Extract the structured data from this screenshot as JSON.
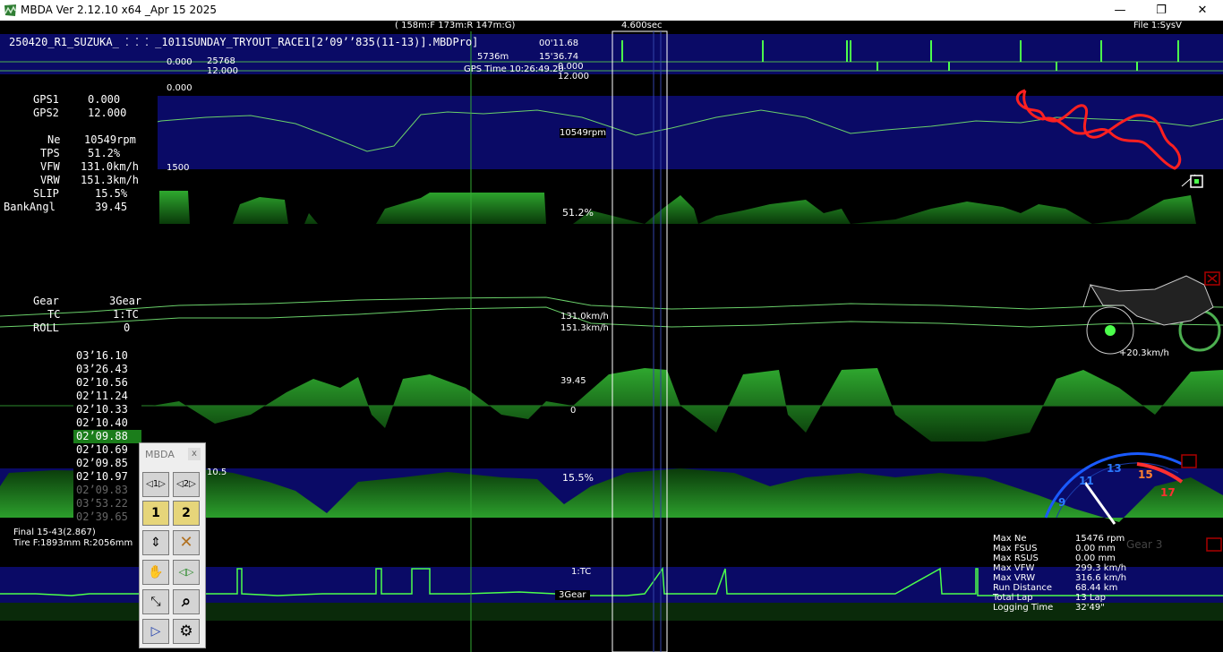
{
  "window": {
    "title": "MBDA Ver 2.12.10 x64 _Apr 15 2025",
    "minimize_label": "—",
    "maximize_label": "❐",
    "close_label": "✕"
  },
  "header": {
    "file_name": "250420_R1_SUZUKA_ ⁚ ⁚ ⁚ _1011SUNDAY_TRYOUT_RACE1[2’09’’835(11-13)].MBDPro]",
    "g_readout": "( 158m:F 173m:R 147m:G)",
    "window_span": "4.600sec",
    "file_tag": "File 1:SysV",
    "time_top": "00'11.68",
    "dist_m": "5736m",
    "time_total": "15'36.74",
    "gps_time": "GPS Time  10:26:49.20",
    "v_zero_1": "0.000",
    "v_25768": "25768",
    "v_12_1": "12.000",
    "v_zero_2": "0.000",
    "v_12_2": "12.000",
    "v_zero_3": "0.000"
  },
  "channels": [
    {
      "name": "GPS1",
      "value": "0.000"
    },
    {
      "name": "GPS2",
      "value": "12.000"
    },
    {
      "name": "Ne",
      "value": "10549rpm"
    },
    {
      "name": "TPS",
      "value": "51.2%"
    },
    {
      "name": "VFW",
      "value": "131.0km/h"
    },
    {
      "name": "VRW",
      "value": "151.3km/h"
    },
    {
      "name": "SLIP",
      "value": "15.5%"
    },
    {
      "name": "BankAngl",
      "value": "39.45"
    },
    {
      "name": "Gear",
      "value": "3Gear"
    },
    {
      "name": "TC",
      "value": "1:TC"
    },
    {
      "name": "ROLL",
      "value": "0"
    }
  ],
  "chart_labels": {
    "rpm": "10549rpm",
    "rpm_min": "1500",
    "tps": "51.2%",
    "vfw": "131.0km/h",
    "vrw": "151.3km/h",
    "bank": "39.45",
    "roll": "0",
    "slip_scale": "10.5",
    "slip": "15.5%",
    "tc": "1:TC",
    "gear": "3Gear",
    "bike_speed": "+20.3km/h"
  },
  "laps": [
    {
      "time": "03’16.10",
      "state": "normal"
    },
    {
      "time": "03’26.43",
      "state": "normal"
    },
    {
      "time": "02’10.56",
      "state": "normal"
    },
    {
      "time": "02’11.24",
      "state": "normal"
    },
    {
      "time": "02’10.33",
      "state": "normal"
    },
    {
      "time": "02’10.40",
      "state": "normal"
    },
    {
      "time": "02’09.88",
      "state": "selected"
    },
    {
      "time": "02’10.69",
      "state": "normal"
    },
    {
      "time": "02’09.85",
      "state": "normal"
    },
    {
      "time": "02’10.97",
      "state": "normal"
    },
    {
      "time": "02’09.83",
      "state": "dim"
    },
    {
      "time": "03’53.22",
      "state": "dim"
    },
    {
      "time": "02’39.65",
      "state": "dim"
    }
  ],
  "lap_info": {
    "final": "Final 15-43(2.867)",
    "tire": "Tire F:1893mm R:2056mm"
  },
  "palette": {
    "title": "MBDA",
    "close": "x",
    "buttons": [
      {
        "id": "prev-marker-1",
        "label": "◁1▷"
      },
      {
        "id": "prev-marker-2",
        "label": "◁2▷"
      },
      {
        "id": "marker-1",
        "label": "1"
      },
      {
        "id": "marker-2",
        "label": "2"
      },
      {
        "id": "fit-vertical",
        "label": "⇕"
      },
      {
        "id": "clear-markers",
        "label": "✕"
      },
      {
        "id": "hand-tool",
        "label": "✋"
      },
      {
        "id": "scroll-horizontal",
        "label": "◁▷"
      },
      {
        "id": "zoom-fit",
        "label": "⤡"
      },
      {
        "id": "zoom-search",
        "label": "⌕"
      },
      {
        "id": "play",
        "label": "▷"
      },
      {
        "id": "settings",
        "label": "⚙"
      }
    ]
  },
  "gauge": {
    "ticks": [
      "9",
      "11",
      "13",
      "15",
      "17"
    ],
    "ghost_gear": "Gear 3"
  },
  "stats": [
    {
      "key": "Max Ne",
      "value": "15476 rpm"
    },
    {
      "key": "Max FSUS",
      "value": "0.00 mm"
    },
    {
      "key": "Max RSUS",
      "value": "0.00 mm"
    },
    {
      "key": "Max VFW",
      "value": "299.3 km/h"
    },
    {
      "key": "Max VRW",
      "value": "316.6 km/h"
    },
    {
      "key": "Run Distance",
      "value": "68.44 km"
    },
    {
      "key": "Total Lap",
      "value": "13 Lap"
    },
    {
      "key": "Logging Time",
      "value": "32'49\""
    }
  ]
}
